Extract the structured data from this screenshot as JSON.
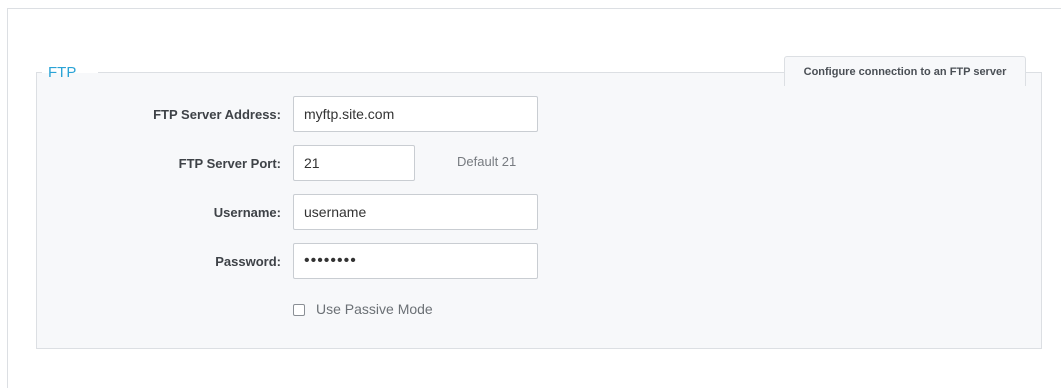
{
  "section": {
    "legend": "FTP",
    "help_tab": "Configure connection to an FTP server"
  },
  "fields": {
    "server_address": {
      "label": "FTP Server Address:",
      "value": "myftp.site.com"
    },
    "server_port": {
      "label": "FTP Server Port:",
      "value": "21",
      "hint": "Default 21"
    },
    "username": {
      "label": "Username:",
      "value": "username"
    },
    "password": {
      "label": "Password:",
      "value": "••••••••"
    }
  },
  "passive_mode": {
    "label": "Use Passive Mode",
    "checked": false
  }
}
